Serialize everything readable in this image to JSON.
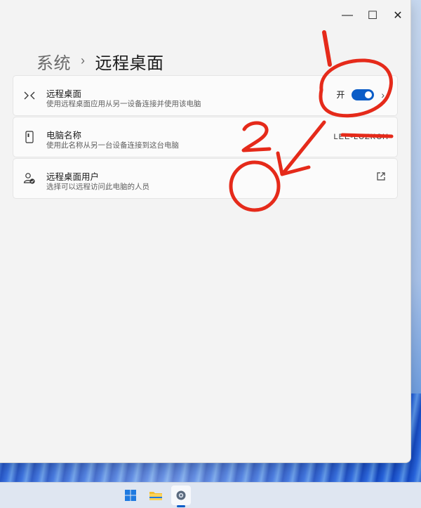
{
  "window": {
    "breadcrumb": {
      "parent": "系统",
      "separator": "›",
      "current": "远程桌面"
    },
    "controls": {
      "minimize": "—",
      "maximize": "☐",
      "close": "✕"
    }
  },
  "settings": {
    "remote_desktop": {
      "title": "远程桌面",
      "subtitle": "使用远程桌面应用从另一设备连接并使用该电脑",
      "toggle_state": "开",
      "toggle_on": true,
      "chevron": "›",
      "icon": "remote-desktop-icon"
    },
    "pc_name": {
      "title": "电脑名称",
      "subtitle": "使用此名称从另一台设备连接到这台电脑",
      "value": "LEE-LUZKCH",
      "icon": "pc-name-icon"
    },
    "remote_users": {
      "title": "远程桌面用户",
      "subtitle": "选择可以远程访问此电脑的人员",
      "icon": "remote-users-icon",
      "link_icon": "external-link-icon"
    }
  },
  "annotations": {
    "label_1": "1",
    "label_2": "2",
    "color": "#e52a1a"
  },
  "taskbar": {
    "icons": [
      "windows-start-icon",
      "file-explorer-icon",
      "settings-icon"
    ],
    "active": "settings-icon"
  }
}
